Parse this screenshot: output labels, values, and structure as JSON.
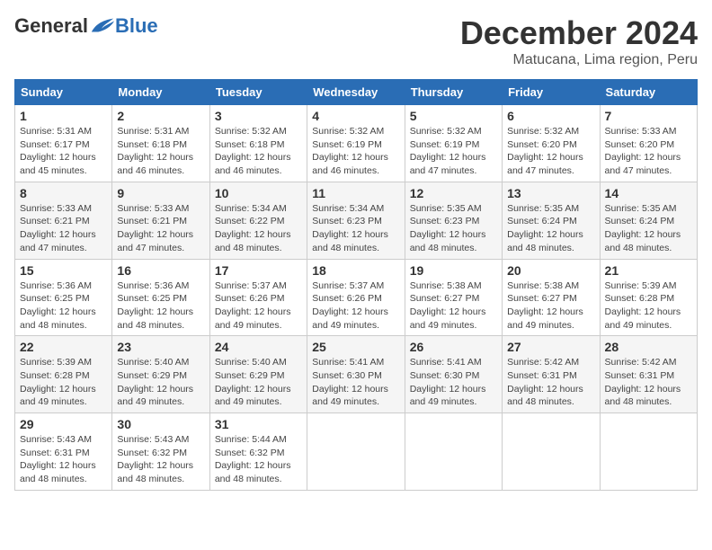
{
  "header": {
    "logo_general": "General",
    "logo_blue": "Blue",
    "month_title": "December 2024",
    "location": "Matucana, Lima region, Peru"
  },
  "days_of_week": [
    "Sunday",
    "Monday",
    "Tuesday",
    "Wednesday",
    "Thursday",
    "Friday",
    "Saturday"
  ],
  "weeks": [
    [
      {
        "day": "1",
        "sunrise": "5:31 AM",
        "sunset": "6:17 PM",
        "daylight": "12 hours and 45 minutes."
      },
      {
        "day": "2",
        "sunrise": "5:31 AM",
        "sunset": "6:18 PM",
        "daylight": "12 hours and 46 minutes."
      },
      {
        "day": "3",
        "sunrise": "5:32 AM",
        "sunset": "6:18 PM",
        "daylight": "12 hours and 46 minutes."
      },
      {
        "day": "4",
        "sunrise": "5:32 AM",
        "sunset": "6:19 PM",
        "daylight": "12 hours and 46 minutes."
      },
      {
        "day": "5",
        "sunrise": "5:32 AM",
        "sunset": "6:19 PM",
        "daylight": "12 hours and 47 minutes."
      },
      {
        "day": "6",
        "sunrise": "5:32 AM",
        "sunset": "6:20 PM",
        "daylight": "12 hours and 47 minutes."
      },
      {
        "day": "7",
        "sunrise": "5:33 AM",
        "sunset": "6:20 PM",
        "daylight": "12 hours and 47 minutes."
      }
    ],
    [
      {
        "day": "8",
        "sunrise": "5:33 AM",
        "sunset": "6:21 PM",
        "daylight": "12 hours and 47 minutes."
      },
      {
        "day": "9",
        "sunrise": "5:33 AM",
        "sunset": "6:21 PM",
        "daylight": "12 hours and 47 minutes."
      },
      {
        "day": "10",
        "sunrise": "5:34 AM",
        "sunset": "6:22 PM",
        "daylight": "12 hours and 48 minutes."
      },
      {
        "day": "11",
        "sunrise": "5:34 AM",
        "sunset": "6:23 PM",
        "daylight": "12 hours and 48 minutes."
      },
      {
        "day": "12",
        "sunrise": "5:35 AM",
        "sunset": "6:23 PM",
        "daylight": "12 hours and 48 minutes."
      },
      {
        "day": "13",
        "sunrise": "5:35 AM",
        "sunset": "6:24 PM",
        "daylight": "12 hours and 48 minutes."
      },
      {
        "day": "14",
        "sunrise": "5:35 AM",
        "sunset": "6:24 PM",
        "daylight": "12 hours and 48 minutes."
      }
    ],
    [
      {
        "day": "15",
        "sunrise": "5:36 AM",
        "sunset": "6:25 PM",
        "daylight": "12 hours and 48 minutes."
      },
      {
        "day": "16",
        "sunrise": "5:36 AM",
        "sunset": "6:25 PM",
        "daylight": "12 hours and 48 minutes."
      },
      {
        "day": "17",
        "sunrise": "5:37 AM",
        "sunset": "6:26 PM",
        "daylight": "12 hours and 49 minutes."
      },
      {
        "day": "18",
        "sunrise": "5:37 AM",
        "sunset": "6:26 PM",
        "daylight": "12 hours and 49 minutes."
      },
      {
        "day": "19",
        "sunrise": "5:38 AM",
        "sunset": "6:27 PM",
        "daylight": "12 hours and 49 minutes."
      },
      {
        "day": "20",
        "sunrise": "5:38 AM",
        "sunset": "6:27 PM",
        "daylight": "12 hours and 49 minutes."
      },
      {
        "day": "21",
        "sunrise": "5:39 AM",
        "sunset": "6:28 PM",
        "daylight": "12 hours and 49 minutes."
      }
    ],
    [
      {
        "day": "22",
        "sunrise": "5:39 AM",
        "sunset": "6:28 PM",
        "daylight": "12 hours and 49 minutes."
      },
      {
        "day": "23",
        "sunrise": "5:40 AM",
        "sunset": "6:29 PM",
        "daylight": "12 hours and 49 minutes."
      },
      {
        "day": "24",
        "sunrise": "5:40 AM",
        "sunset": "6:29 PM",
        "daylight": "12 hours and 49 minutes."
      },
      {
        "day": "25",
        "sunrise": "5:41 AM",
        "sunset": "6:30 PM",
        "daylight": "12 hours and 49 minutes."
      },
      {
        "day": "26",
        "sunrise": "5:41 AM",
        "sunset": "6:30 PM",
        "daylight": "12 hours and 49 minutes."
      },
      {
        "day": "27",
        "sunrise": "5:42 AM",
        "sunset": "6:31 PM",
        "daylight": "12 hours and 48 minutes."
      },
      {
        "day": "28",
        "sunrise": "5:42 AM",
        "sunset": "6:31 PM",
        "daylight": "12 hours and 48 minutes."
      }
    ],
    [
      {
        "day": "29",
        "sunrise": "5:43 AM",
        "sunset": "6:31 PM",
        "daylight": "12 hours and 48 minutes."
      },
      {
        "day": "30",
        "sunrise": "5:43 AM",
        "sunset": "6:32 PM",
        "daylight": "12 hours and 48 minutes."
      },
      {
        "day": "31",
        "sunrise": "5:44 AM",
        "sunset": "6:32 PM",
        "daylight": "12 hours and 48 minutes."
      },
      null,
      null,
      null,
      null
    ]
  ]
}
